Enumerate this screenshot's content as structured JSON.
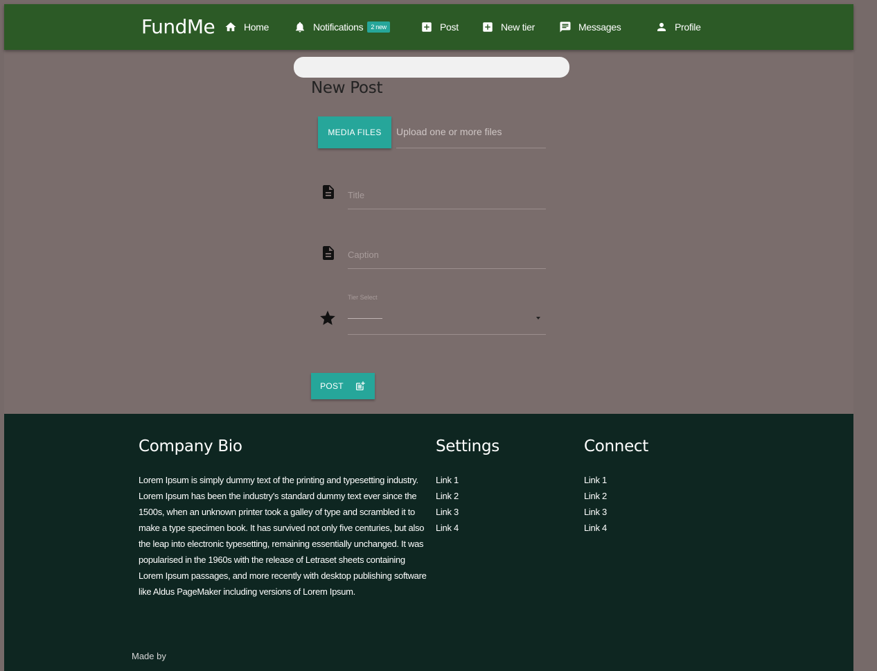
{
  "navbar": {
    "brand": "FundMe",
    "items": [
      {
        "label": "Home",
        "icon": "home-icon"
      },
      {
        "label": "Notifications",
        "icon": "bell-icon",
        "badge": "2 new"
      },
      {
        "label": "Post",
        "icon": "add-box-icon"
      },
      {
        "label": "New tier",
        "icon": "add-box-icon"
      },
      {
        "label": "Messages",
        "icon": "message-icon"
      },
      {
        "label": "Profile",
        "icon": "person-icon"
      }
    ]
  },
  "form": {
    "title": "New Post",
    "media_button": "MEDIA FILES",
    "file_placeholder": "Upload one or more files",
    "title_placeholder": "Title",
    "caption_placeholder": "Caption",
    "tier_label": "Tier Select",
    "tier_value": "",
    "post_button": "POST"
  },
  "footer": {
    "bio_heading": "Company Bio",
    "bio_text": "Lorem Ipsum is simply dummy text of the printing and typesetting industry. Lorem Ipsum has been the industry's standard dummy text ever since the 1500s, when an unknown printer took a galley of type and scrambled it to make a type specimen book. It has survived not only five centuries, but also the leap into electronic typesetting, remaining essentially unchanged. It was popularised in the 1960s with the release of Letraset sheets containing Lorem Ipsum passages, and more recently with desktop publishing software like Aldus PageMaker including versions of Lorem Ipsum.",
    "settings_heading": "Settings",
    "settings_links": [
      "Link 1",
      "Link 2",
      "Link 3",
      "Link 4"
    ],
    "connect_heading": "Connect",
    "connect_links": [
      "Link 1",
      "Link 2",
      "Link 3",
      "Link 4"
    ],
    "made_by": "Made by"
  },
  "colors": {
    "navbar": "#2c5a26",
    "background": "#7a6d6c",
    "accent": "#26a69a",
    "footer": "#0e2621"
  }
}
